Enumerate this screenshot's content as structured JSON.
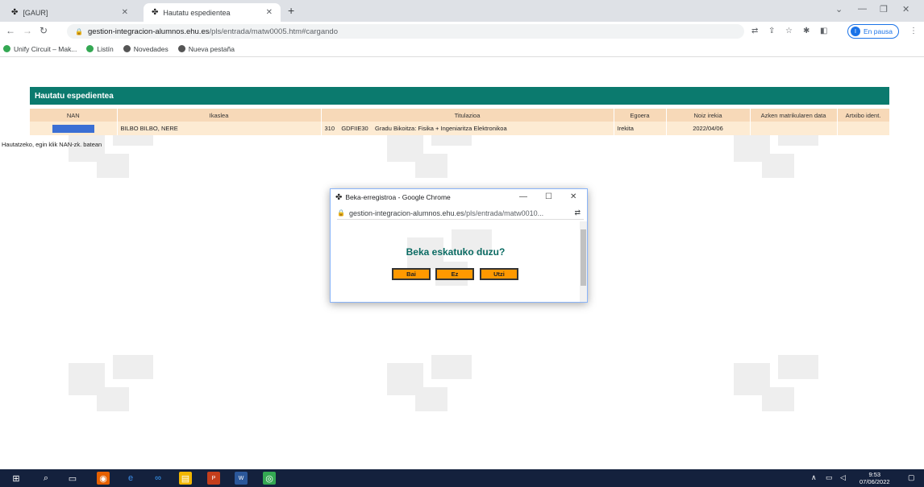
{
  "browser": {
    "tabs": [
      {
        "label": "[GAUR]"
      },
      {
        "label": "Hautatu espedientea"
      }
    ],
    "url_host": "gestion-integracion-alumnos.ehu.es",
    "url_path": "/pls/entrada/matw0005.htm#cargando",
    "profile_status": "En pausa",
    "profile_initial": "I",
    "bookmarks": [
      {
        "label": "Unify Circuit – Mak..."
      },
      {
        "label": "Listín"
      },
      {
        "label": "Novedades"
      },
      {
        "label": "Nueva pestaña"
      }
    ]
  },
  "page": {
    "panel_title": "Hautatu espedientea",
    "columns": [
      "NAN",
      "Ikaslea",
      "Titulazioa",
      "Egoera",
      "Noiz irekia",
      "Azken matrikularen data",
      "Artxibo ident."
    ],
    "row": {
      "nan": "",
      "ikaslea": "BILBO BILBO, NERE",
      "titulazioa": "310    GDFIIE30    Gradu Bikoitza: Fisika + Ingeniaritza Elektronikoa",
      "egoera": "Irekita",
      "noiz_irekia": "2022/04/06",
      "azken_matrikula": "",
      "artxibo": ""
    },
    "hint": "Hautatzeko, egin klik NAN-zk. batean"
  },
  "popup": {
    "title": "Beka-erregistroa - Google Chrome",
    "url_host": "gestion-integracion-alumnos.ehu.es",
    "url_path": "/pls/entrada/matw0010...",
    "question": "Beka eskatuko duzu?",
    "buttons": [
      "Bai",
      "Ez",
      "Utzi"
    ]
  },
  "taskbar": {
    "time": "9:53",
    "date": "07/06/2022"
  },
  "colors": {
    "panel_header": "#0b7a6e",
    "table_header": "#f7d9b8",
    "table_row": "#fdebd3",
    "question_text": "#0b6b63",
    "popup_button": "#ff9900",
    "taskbar": "#14213d"
  }
}
